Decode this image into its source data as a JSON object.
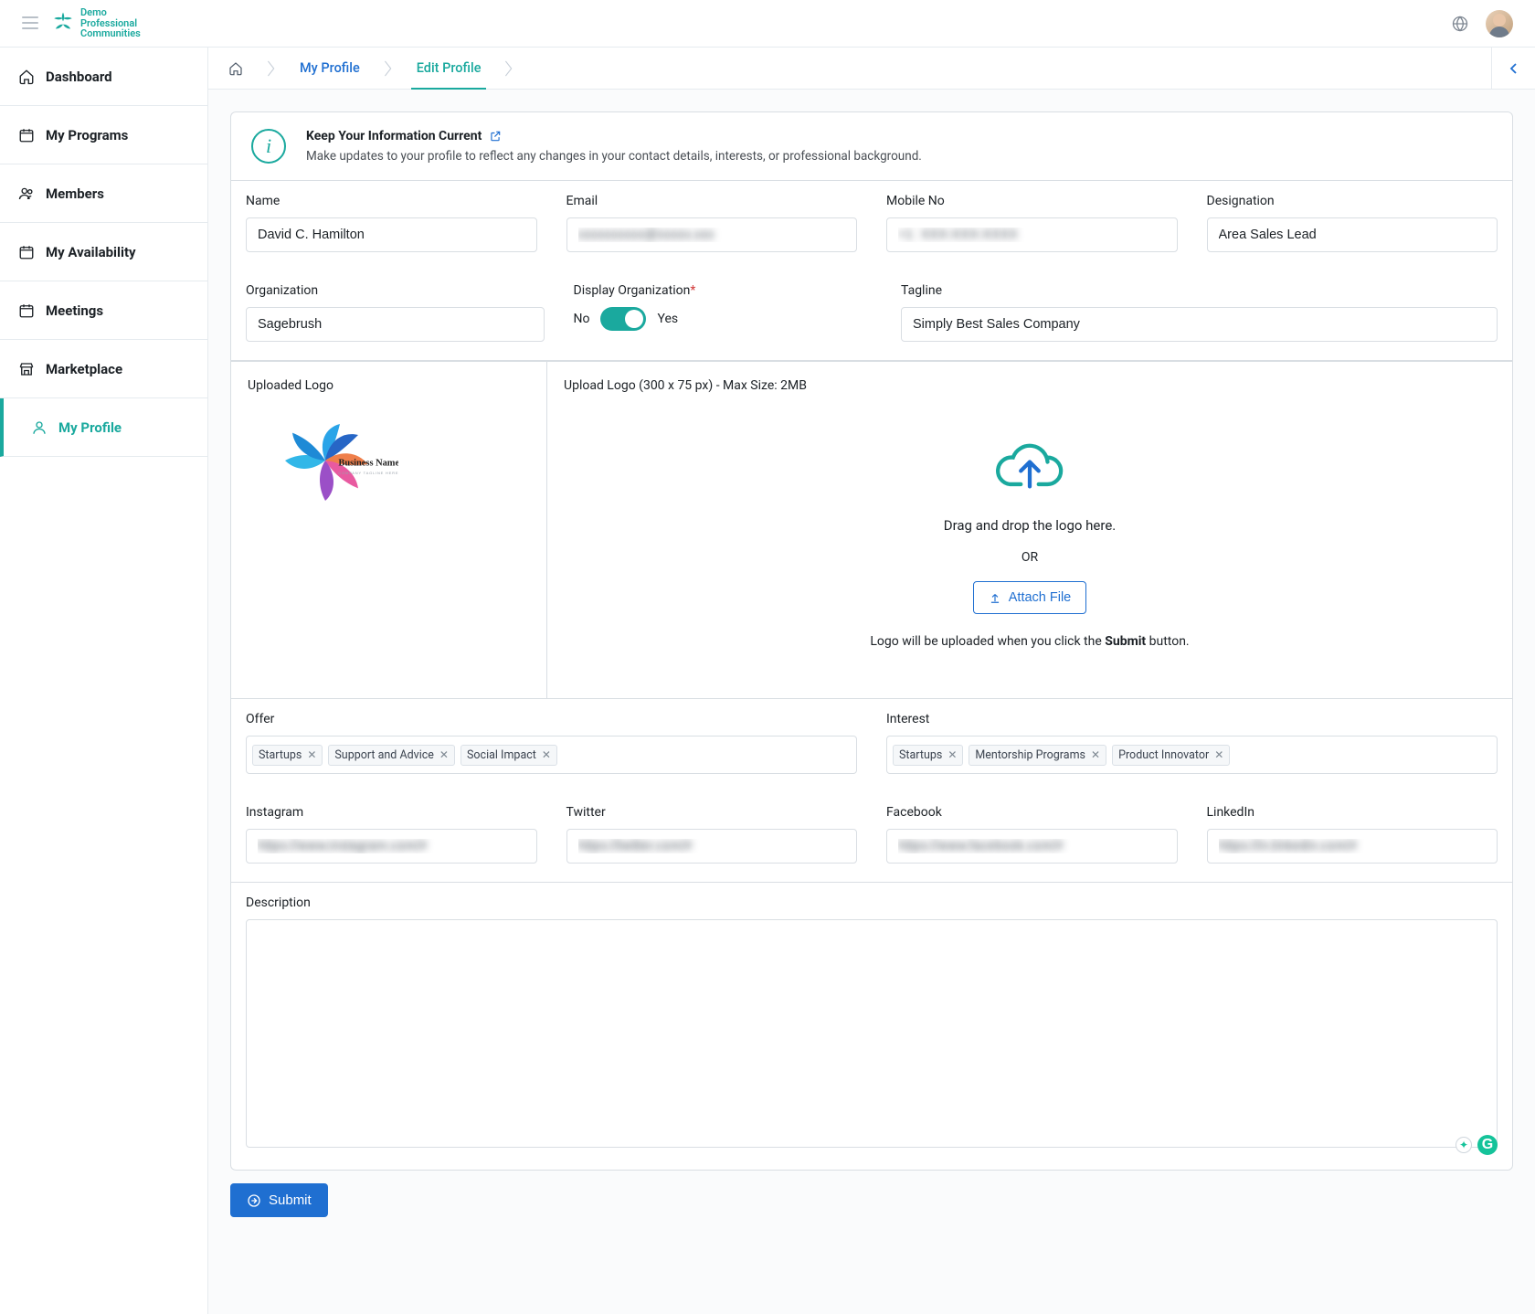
{
  "app": {
    "brand_line1": "Demo",
    "brand_line2": "Professional",
    "brand_line3": "Communities"
  },
  "sidebar": {
    "dashboard": "Dashboard",
    "my_programs": "My Programs",
    "members": "Members",
    "my_availability": "My Availability",
    "meetings": "Meetings",
    "marketplace": "Marketplace",
    "my_profile": "My Profile"
  },
  "breadcrumb": {
    "my_profile": "My Profile",
    "edit_profile": "Edit Profile"
  },
  "banner": {
    "title": "Keep Your Information Current",
    "desc": "Make updates to your profile to reflect any changes in your contact details, interests, or professional background."
  },
  "labels": {
    "name": "Name",
    "email": "Email",
    "mobile": "Mobile No",
    "designation": "Designation",
    "organization": "Organization",
    "display_org": "Display Organization",
    "no": "No",
    "yes": "Yes",
    "tagline": "Tagline",
    "uploaded_logo": "Uploaded Logo",
    "upload_logo": "Upload Logo (300 x 75 px) - Max Size: 2MB",
    "drag_drop": "Drag and drop the logo here.",
    "or": "OR",
    "attach_file": "Attach File",
    "upload_note_pre": "Logo will be uploaded when you click the ",
    "upload_note_bold": "Submit",
    "upload_note_post": " button.",
    "offer": "Offer",
    "interest": "Interest",
    "instagram": "Instagram",
    "twitter": "Twitter",
    "facebook": "Facebook",
    "linkedin": "LinkedIn",
    "description": "Description",
    "submit": "Submit",
    "business_name": "Business Name",
    "business_tagline": "COMPANY TAGLINE HERE"
  },
  "values": {
    "name": "David C. Hamilton",
    "email": "xxxxxxxxxx@xxxxx.xxx",
    "mobile": "+1  XXX-XXX-XXXX",
    "designation": "Area Sales Lead",
    "organization": "Sagebrush",
    "tagline": "Simply Best Sales Company",
    "instagram": "https://www.instagram.com/#",
    "twitter": "https://twitter.com/#",
    "facebook": "https://www.facebook.com/#",
    "linkedin": "https://in.linkedin.com/#",
    "description": ""
  },
  "offer_tags": [
    "Startups",
    "Support and Advice",
    "Social Impact"
  ],
  "interest_tags": [
    "Startups",
    "Mentorship Programs",
    "Product Innovator"
  ]
}
